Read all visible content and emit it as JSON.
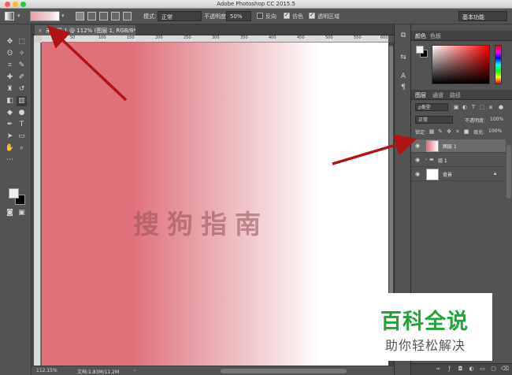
{
  "window": {
    "title": "Adobe Photoshop CC 2015.5"
  },
  "options_bar": {
    "mode_label": "模式:",
    "mode_value": "正常",
    "opacity_label": "不透明度:",
    "opacity_value": "50%",
    "reverse_label": "反向",
    "dither_label": "仿色",
    "transparency_label": "透明区域",
    "workspace_value": "基本功能",
    "reverse_checked": false,
    "dither_checked": true,
    "transparency_checked": true
  },
  "document": {
    "tab_title": "未标题-1 @ 112% (图层 1, RGB/8*)",
    "close_glyph": "×",
    "ruler_ticks": [
      "50",
      "100",
      "150",
      "200",
      "250",
      "300",
      "350",
      "400",
      "450",
      "500",
      "550",
      "600"
    ]
  },
  "canvas": {
    "watermark": "搜狗指南",
    "gradient_colors": [
      "#e0707a",
      "#ffffff"
    ]
  },
  "status_bar": {
    "zoom": "112.15%",
    "doc_info": "文档:1.83M/11.2M",
    "caret": "›"
  },
  "color_panel": {
    "tab_color": "颜色",
    "tab_swatches": "色板",
    "foreground": "#f2f2f2",
    "background": "#000000",
    "hue": "#ff0000"
  },
  "layers_panel": {
    "tab_layers": "图层",
    "tab_channels": "通道",
    "tab_paths": "路径",
    "filter_kind": "ρ类型",
    "blend_mode": "正常",
    "opacity_label": "不透明度:",
    "opacity_value": "100%",
    "lock_label": "锁定:",
    "fill_label": "填充:",
    "fill_value": "100%",
    "layers": [
      {
        "name": "图层 1",
        "selected": true,
        "type": "gradient"
      },
      {
        "name": "组 1",
        "selected": false,
        "type": "group"
      },
      {
        "name": "背景",
        "selected": false,
        "type": "background",
        "locked": true
      }
    ]
  },
  "logo": {
    "main": "百科全说",
    "sub": "助你轻松解决"
  },
  "colors": {
    "arrow": "#b01515",
    "logo_green": "#21a43a"
  }
}
